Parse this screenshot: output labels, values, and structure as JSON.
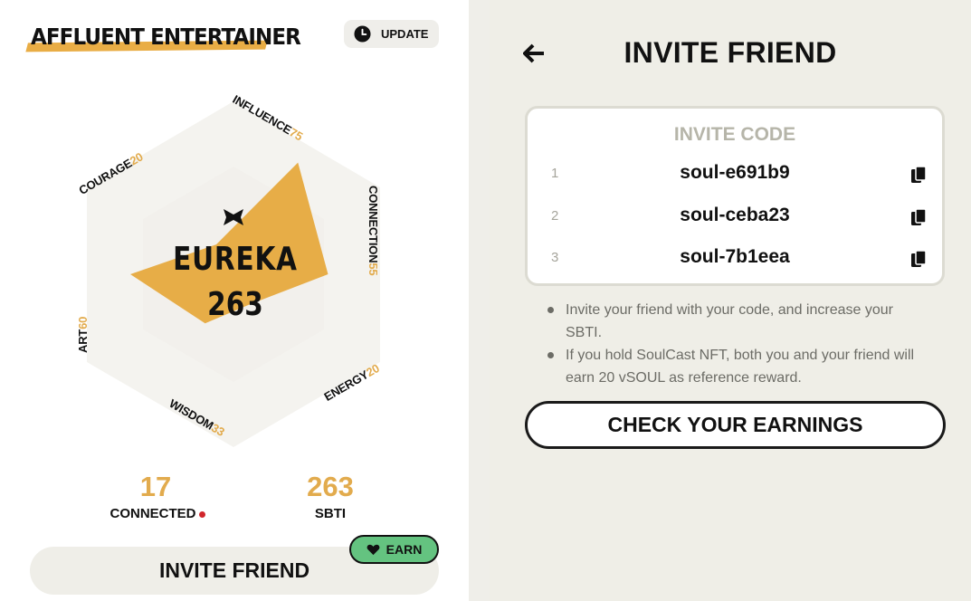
{
  "profile": {
    "title": "AFFLUENT ENTERTAINER",
    "update_label": "UPDATE",
    "soul_name": "EUREKA",
    "soul_score": "263",
    "stats": [
      {
        "name": "INFLUENCE",
        "value": 75
      },
      {
        "name": "CONNECTION",
        "value": 55
      },
      {
        "name": "ENERGY",
        "value": 20
      },
      {
        "name": "WISDOM",
        "value": 33
      },
      {
        "name": "ART",
        "value": 60
      },
      {
        "name": "COURAGE",
        "value": 20
      }
    ],
    "connected_count": "17",
    "connected_label": "CONNECTED",
    "sbti_value": "263",
    "sbti_label": "SBTI",
    "invite_label": "INVITE FRIEND",
    "earn_label": "EARN"
  },
  "invite": {
    "title": "INVITE FRIEND",
    "code_header": "INVITE CODE",
    "codes": [
      {
        "index": "1",
        "code": "soul-e691b9"
      },
      {
        "index": "2",
        "code": "soul-ceba23"
      },
      {
        "index": "3",
        "code": "soul-7b1eea"
      }
    ],
    "notes": [
      "Invite your friend with your code, and increase your SBTI.",
      "If you hold SoulCast NFT, both you and your friend will earn 20 vSOUL as reference reward."
    ],
    "check_label": "CHECK YOUR EARNINGS"
  },
  "colors": {
    "accent": "#e2ab4d",
    "radar_fill": "#e7ad47",
    "earn_green": "#64c380",
    "alert_red": "#d1262c"
  },
  "icons": {
    "update": "clock-icon",
    "emblem": "eureka-emblem-icon",
    "earn": "heart-icon",
    "back": "arrow-left-icon",
    "copy": "copy-icon"
  }
}
